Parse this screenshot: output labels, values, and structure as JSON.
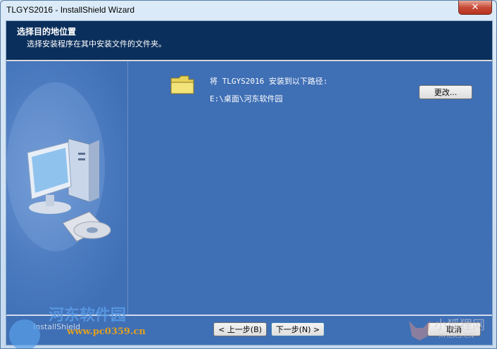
{
  "window": {
    "title": "TLGYS2016 - InstallShield Wizard",
    "close_glyph": "✕"
  },
  "header": {
    "title": "选择目的地位置",
    "subtitle": "选择安装程序在其中安装文件的文件夹。"
  },
  "destination": {
    "label": "将 TLGYS2016 安装到以下路径:",
    "path": "E:\\桌面\\河东软件园",
    "change_label": "更改..."
  },
  "footer": {
    "brand_name": "InstallShield",
    "back_label": "< 上一步(B)",
    "next_label": "下一步(N) >",
    "cancel_label": "取消"
  },
  "watermarks": {
    "left_text": "河东软件园",
    "left_url": "www.pc0359.cn",
    "right_text": "小狐狸网",
    "right_url": "XHLKS.CN"
  },
  "colors": {
    "header_bg": "#0b2f5c",
    "panel_bg": "#3f6fb5"
  },
  "icons": {
    "folder": "folder-icon",
    "computer": "computer-icon"
  }
}
